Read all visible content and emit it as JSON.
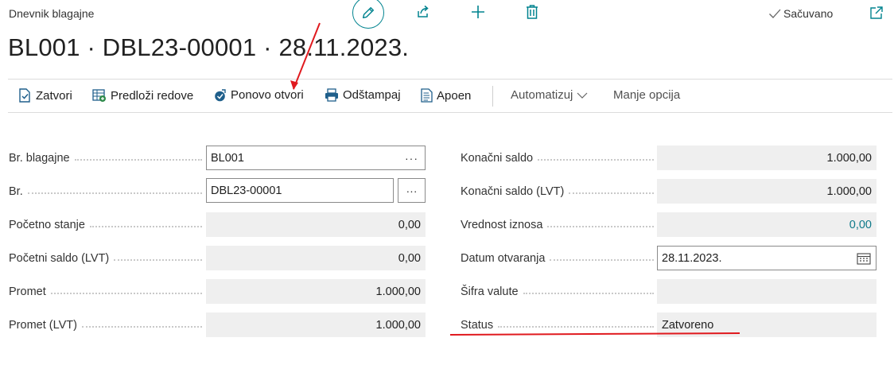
{
  "header": {
    "breadcrumb": "Dnevnik blagajne",
    "saved_label": "Sačuvano",
    "title": "BL001 · DBL23-00001 · 28.11.2023."
  },
  "actions": [
    {
      "label": "Zatvori",
      "icon": "close-document-icon"
    },
    {
      "label": "Predloži redove",
      "icon": "suggest-lines-icon"
    },
    {
      "label": "Ponovo otvori",
      "icon": "reopen-icon"
    },
    {
      "label": "Odštampaj",
      "icon": "print-icon"
    },
    {
      "label": "Apoen",
      "icon": "denomination-icon"
    },
    {
      "label": "Automatizuj",
      "icon": "chevron-down-icon"
    },
    {
      "label": "Manje opcija"
    }
  ],
  "fields_left": [
    {
      "label": "Br. blagajne",
      "value": "BL001"
    },
    {
      "label": "Br.",
      "value": "DBL23-00001"
    },
    {
      "label": "Početno stanje",
      "value": "0,00"
    },
    {
      "label": "Početni saldo (LVT)",
      "value": "0,00"
    },
    {
      "label": "Promet",
      "value": "1.000,00"
    },
    {
      "label": "Promet (LVT)",
      "value": "1.000,00"
    }
  ],
  "fields_right": [
    {
      "label": "Konačni saldo",
      "value": "1.000,00"
    },
    {
      "label": "Konačni saldo (LVT)",
      "value": "1.000,00"
    },
    {
      "label": "Vrednost iznosa",
      "value": "0,00"
    },
    {
      "label": "Datum otvaranja",
      "value": "28.11.2023."
    },
    {
      "label": "Šifra valute",
      "value": ""
    },
    {
      "label": "Status",
      "value": "Zatvoreno"
    }
  ],
  "colors": {
    "accent": "#00838f",
    "annotation": "#e0191e",
    "link_value": "#0f7a8a"
  }
}
